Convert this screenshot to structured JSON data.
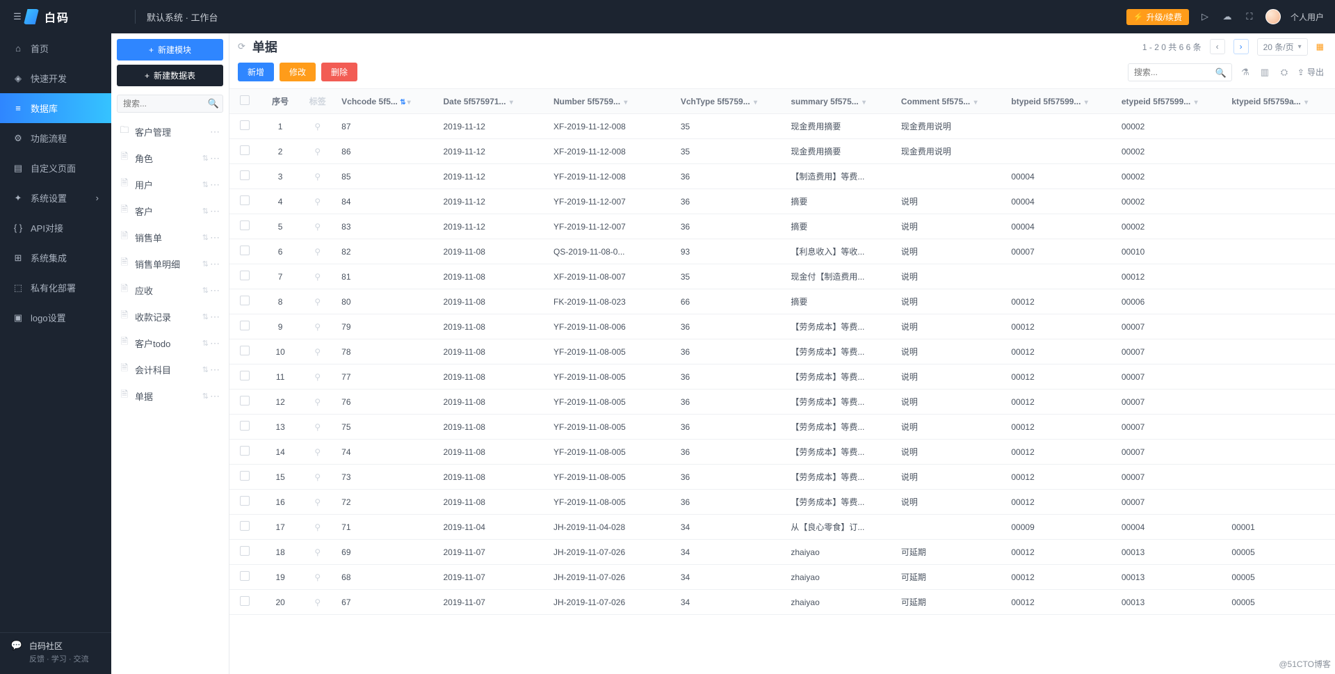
{
  "header": {
    "brand": "白码",
    "breadcrumb": "默认系统 · 工作台",
    "upgrade": "升级/续费",
    "user": "个人用户"
  },
  "nav": [
    {
      "icon": "home",
      "label": "首页"
    },
    {
      "icon": "cube",
      "label": "快速开发"
    },
    {
      "icon": "db",
      "label": "数据库",
      "active": true
    },
    {
      "icon": "flow",
      "label": "功能流程"
    },
    {
      "icon": "page",
      "label": "自定义页面"
    },
    {
      "icon": "gear",
      "label": "系统设置",
      "hasSub": true
    },
    {
      "icon": "api",
      "label": "API对接"
    },
    {
      "icon": "integ",
      "label": "系统集成"
    },
    {
      "icon": "deploy",
      "label": "私有化部署"
    },
    {
      "icon": "logo",
      "label": "logo设置"
    }
  ],
  "navFooter": {
    "title": "白码社区",
    "sub": "反馈 · 学习 · 交流"
  },
  "mid": {
    "newModule": "新建模块",
    "newTable": "新建数据表",
    "searchPlaceholder": "搜索...",
    "items": [
      {
        "type": "folder",
        "label": "客户管理"
      },
      {
        "type": "file",
        "label": "角色"
      },
      {
        "type": "file",
        "label": "用户"
      },
      {
        "type": "file",
        "label": "客户"
      },
      {
        "type": "file",
        "label": "销售单"
      },
      {
        "type": "file",
        "label": "销售单明细"
      },
      {
        "type": "file",
        "label": "应收"
      },
      {
        "type": "file",
        "label": "收款记录"
      },
      {
        "type": "file",
        "label": "客户todo"
      },
      {
        "type": "file",
        "label": "会计科目"
      },
      {
        "type": "file",
        "label": "单据"
      }
    ]
  },
  "page": {
    "title": "单据",
    "rangeText": "1 - 2 0 共 6 6 条",
    "pageSize": "20 条/页",
    "searchPlaceholder": "搜索...",
    "buttons": {
      "add": "新增",
      "edit": "修改",
      "del": "删除"
    },
    "export": "导出"
  },
  "columns": [
    "序号",
    "标签",
    "Vchcode 5f5...",
    "Date 5f575971...",
    "Number 5f5759...",
    "VchType 5f5759...",
    "summary 5f575...",
    "Comment 5f575...",
    "btypeid 5f57599...",
    "etypeid 5f57599...",
    "ktypeid 5f5759a..."
  ],
  "rows": [
    {
      "idx": 1,
      "vch": "87",
      "date": "2019-11-12",
      "num": "XF-2019-11-12-008",
      "type": "35",
      "sum": "现金费用摘要",
      "com": "现金费用说明",
      "b": "",
      "e": "00002",
      "k": ""
    },
    {
      "idx": 2,
      "vch": "86",
      "date": "2019-11-12",
      "num": "XF-2019-11-12-008",
      "type": "35",
      "sum": "现金费用摘要",
      "com": "现金费用说明",
      "b": "",
      "e": "00002",
      "k": ""
    },
    {
      "idx": 3,
      "vch": "85",
      "date": "2019-11-12",
      "num": "YF-2019-11-12-008",
      "type": "36",
      "sum": "【制造费用】等费...",
      "com": "",
      "b": "00004",
      "e": "00002",
      "k": ""
    },
    {
      "idx": 4,
      "vch": "84",
      "date": "2019-11-12",
      "num": "YF-2019-11-12-007",
      "type": "36",
      "sum": "摘要",
      "com": "说明",
      "b": "00004",
      "e": "00002",
      "k": ""
    },
    {
      "idx": 5,
      "vch": "83",
      "date": "2019-11-12",
      "num": "YF-2019-11-12-007",
      "type": "36",
      "sum": "摘要",
      "com": "说明",
      "b": "00004",
      "e": "00002",
      "k": ""
    },
    {
      "idx": 6,
      "vch": "82",
      "date": "2019-11-08",
      "num": "QS-2019-11-08-0...",
      "type": "93",
      "sum": "【利息收入】等收...",
      "com": "说明",
      "b": "00007",
      "e": "00010",
      "k": ""
    },
    {
      "idx": 7,
      "vch": "81",
      "date": "2019-11-08",
      "num": "XF-2019-11-08-007",
      "type": "35",
      "sum": "现金付【制造费用...",
      "com": "说明",
      "b": "",
      "e": "00012",
      "k": ""
    },
    {
      "idx": 8,
      "vch": "80",
      "date": "2019-11-08",
      "num": "FK-2019-11-08-023",
      "type": "66",
      "sum": "摘要",
      "com": "说明",
      "b": "00012",
      "e": "00006",
      "k": ""
    },
    {
      "idx": 9,
      "vch": "79",
      "date": "2019-11-08",
      "num": "YF-2019-11-08-006",
      "type": "36",
      "sum": "【劳务成本】等费...",
      "com": "说明",
      "b": "00012",
      "e": "00007",
      "k": ""
    },
    {
      "idx": 10,
      "vch": "78",
      "date": "2019-11-08",
      "num": "YF-2019-11-08-005",
      "type": "36",
      "sum": "【劳务成本】等费...",
      "com": "说明",
      "b": "00012",
      "e": "00007",
      "k": ""
    },
    {
      "idx": 11,
      "vch": "77",
      "date": "2019-11-08",
      "num": "YF-2019-11-08-005",
      "type": "36",
      "sum": "【劳务成本】等费...",
      "com": "说明",
      "b": "00012",
      "e": "00007",
      "k": ""
    },
    {
      "idx": 12,
      "vch": "76",
      "date": "2019-11-08",
      "num": "YF-2019-11-08-005",
      "type": "36",
      "sum": "【劳务成本】等费...",
      "com": "说明",
      "b": "00012",
      "e": "00007",
      "k": ""
    },
    {
      "idx": 13,
      "vch": "75",
      "date": "2019-11-08",
      "num": "YF-2019-11-08-005",
      "type": "36",
      "sum": "【劳务成本】等费...",
      "com": "说明",
      "b": "00012",
      "e": "00007",
      "k": ""
    },
    {
      "idx": 14,
      "vch": "74",
      "date": "2019-11-08",
      "num": "YF-2019-11-08-005",
      "type": "36",
      "sum": "【劳务成本】等费...",
      "com": "说明",
      "b": "00012",
      "e": "00007",
      "k": ""
    },
    {
      "idx": 15,
      "vch": "73",
      "date": "2019-11-08",
      "num": "YF-2019-11-08-005",
      "type": "36",
      "sum": "【劳务成本】等费...",
      "com": "说明",
      "b": "00012",
      "e": "00007",
      "k": ""
    },
    {
      "idx": 16,
      "vch": "72",
      "date": "2019-11-08",
      "num": "YF-2019-11-08-005",
      "type": "36",
      "sum": "【劳务成本】等费...",
      "com": "说明",
      "b": "00012",
      "e": "00007",
      "k": ""
    },
    {
      "idx": 17,
      "vch": "71",
      "date": "2019-11-04",
      "num": "JH-2019-11-04-028",
      "type": "34",
      "sum": "从【良心零食】订...",
      "com": "",
      "b": "00009",
      "e": "00004",
      "k": "00001"
    },
    {
      "idx": 18,
      "vch": "69",
      "date": "2019-11-07",
      "num": "JH-2019-11-07-026",
      "type": "34",
      "sum": "zhaiyao",
      "com": "可延期",
      "b": "00012",
      "e": "00013",
      "k": "00005"
    },
    {
      "idx": 19,
      "vch": "68",
      "date": "2019-11-07",
      "num": "JH-2019-11-07-026",
      "type": "34",
      "sum": "zhaiyao",
      "com": "可延期",
      "b": "00012",
      "e": "00013",
      "k": "00005"
    },
    {
      "idx": 20,
      "vch": "67",
      "date": "2019-11-07",
      "num": "JH-2019-11-07-026",
      "type": "34",
      "sum": "zhaiyao",
      "com": "可延期",
      "b": "00012",
      "e": "00013",
      "k": "00005"
    }
  ],
  "watermark": "@51CTO博客"
}
